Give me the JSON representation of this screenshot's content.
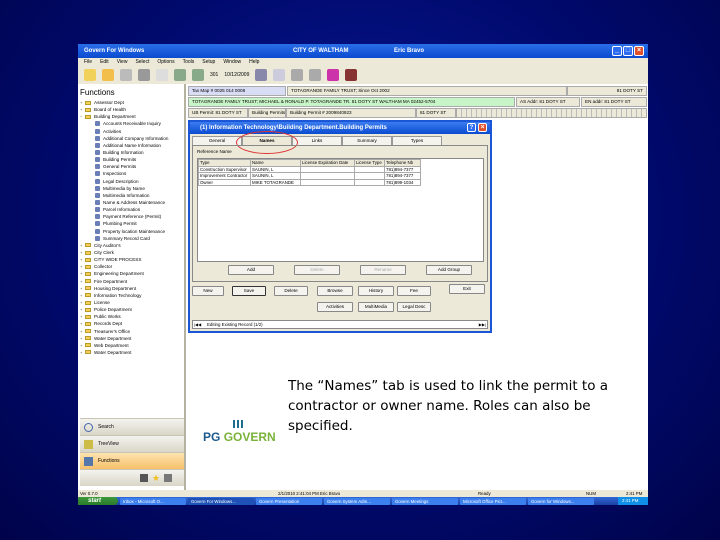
{
  "window": {
    "title": "Govern For Windows",
    "city": "CITY OF WALTHAM",
    "user": "Eric Bravo"
  },
  "menu": [
    "File",
    "Edit",
    "View",
    "Select",
    "Options",
    "Tools",
    "Setup",
    "Window",
    "Help"
  ],
  "toolbar": {
    "num": "301",
    "date": "10/12/2009"
  },
  "functions": {
    "title": "Functions",
    "tree_top": [
      "Assessor Dept",
      "Board of Health",
      "Building Department"
    ],
    "building_children": [
      "Accounts Receivable Inquiry",
      "Activities",
      "Additional Company Information",
      "Additional Name Information",
      "Building Information",
      "Building Permits",
      "General Permits",
      "Inspections",
      "Legal Description",
      "Multimedia by Name",
      "Multimedia Information",
      "Name & Address Maintenance",
      "Parcel Information",
      "Payment Reference (Permit)",
      "Plumbing Permit",
      "Property location Maintenance",
      "Summary Record Card"
    ],
    "tree_bottom": [
      "City Auditor's",
      "City Clerk",
      "CITY WIDE PROCESS",
      "Collector",
      "Engineering Department",
      "Fire Department",
      "Housing Department",
      "Information Technology",
      "License",
      "Police Department",
      "Public Works",
      "Records Dept",
      "Treasurer's Office",
      "Water Department",
      "Web Department",
      "Water Department"
    ]
  },
  "nav": {
    "search": "Search",
    "treeview": "TreeView",
    "functions": "Functions"
  },
  "info": {
    "map": "Tax Map # 0025 014 0008",
    "owner_short": "TOTAGRANDE FAMILY TRUST; Since Oct 2002",
    "addr_right": "81 DOTY ST",
    "owner_full": "TOTAGRANDE FAMILY TRUST; MICHAEL & RONALD P. TOTAGRANDE TR. 81 DOTY ST  WALTHAM MA 02452-5704",
    "as_addr": "AS Addr: 81 DOTY ST",
    "en_addr": "EN addr: 81 DOTY ST",
    "ub_permit": "UB Permit: 81 DOTY ST",
    "building_permits": "Building Permits",
    "permit_no": "Building Permit # 2009840923",
    "permit_addr": "81 DOTY ST"
  },
  "dialog": {
    "title": "(1) Information Technology\\Building Department.Building Permits",
    "tabs": [
      "General",
      "Names",
      "Links",
      "Summary",
      "Types"
    ],
    "ref_label": "Reference Name",
    "columns": [
      "Type",
      "Name",
      "License Expiration Date",
      "License Type",
      "Telephone Nb"
    ],
    "rows": [
      [
        "Construction Supervisor",
        "SAUNIN, L",
        "",
        "",
        "781)894-7377"
      ],
      [
        "Improvement Contractor",
        "SAUNIN, L",
        "",
        "",
        "781)894-7377"
      ],
      [
        "Owner",
        "MIKE TOTAGRANDE",
        "",
        "",
        "781)899-1034"
      ]
    ],
    "panel_buttons": [
      "Add",
      "Delete",
      "Rename",
      "Add Group"
    ],
    "buttons_row1": [
      "New",
      "Save",
      "Delete",
      "Browse",
      "History",
      "Fee",
      "Exit"
    ],
    "buttons_row2": [
      "Activities",
      "MultiMedia",
      "Legal Desc"
    ],
    "status": "Editing Existing Record (1/2)"
  },
  "statusbar": {
    "left": "Ver 0.7.0",
    "mid": "2/1/2010 2:41:04 PM Eric Bravo",
    "r1": "Ready",
    "r2": "NUM",
    "r3": "2:41 PM"
  },
  "taskbar": {
    "start": "start",
    "tasks": [
      "Inbox - Microsoft O...",
      "Govern For Windows...",
      "Govern Presentation",
      "Govern System Adm...",
      "Govern Meetings",
      "Microsoft Office Pict...",
      "Govern for Windows..."
    ],
    "clock": "2:41 PM"
  },
  "slide": {
    "caption": "The “Names” tab is used to link the permit to a contractor or owner name. Roles can also be specified.",
    "logo_pg": "PG",
    "logo_govern": "GOVERN"
  }
}
